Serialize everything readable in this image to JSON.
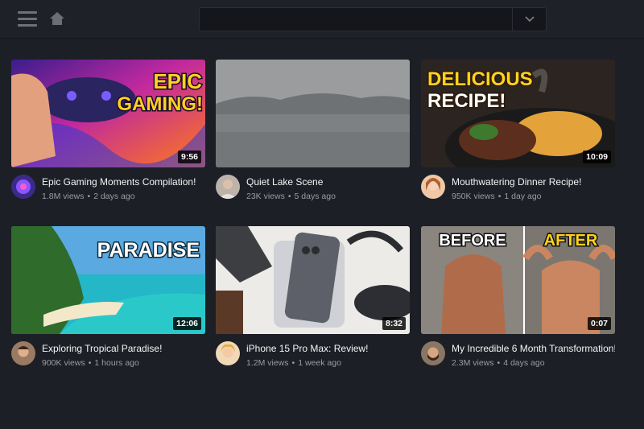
{
  "header": {
    "menu_icon": "hamburger-menu-icon",
    "home_icon": "home-icon",
    "search": {
      "value": "",
      "placeholder": "",
      "dropdown_icon": "chevron-down-icon"
    }
  },
  "videos": [
    {
      "title": "Epic Gaming Moments Compilation!",
      "views": "1.8M views",
      "age": "2 days ago",
      "duration": "9:56",
      "thumb_text": [
        "EPIC",
        "GAMING!"
      ]
    },
    {
      "title": "Quiet Lake Scene",
      "views": "23K views",
      "age": "5 days ago",
      "duration": "",
      "thumb_text": []
    },
    {
      "title": "Mouthwatering Dinner Recipe!",
      "views": "950K views",
      "age": "1 day ago",
      "duration": "10:09",
      "thumb_text": [
        "DELICIOUS",
        "RECIPE!"
      ]
    },
    {
      "title": "Exploring Tropical Paradise!",
      "views": "900K views",
      "age": "1 hours ago",
      "duration": "12:06",
      "thumb_text": [
        "PARADISE"
      ]
    },
    {
      "title": "iPhone 15 Pro Max: Review!",
      "views": "1.2M views",
      "age": "1 week ago",
      "duration": "8:32",
      "thumb_text": []
    },
    {
      "title": "My Incredible 6 Month Transformation!",
      "views": "2.3M views",
      "age": "4 days ago",
      "duration": "0:07",
      "thumb_text": [
        "BEFORE",
        "AFTER"
      ]
    }
  ],
  "meta_separator": "•"
}
